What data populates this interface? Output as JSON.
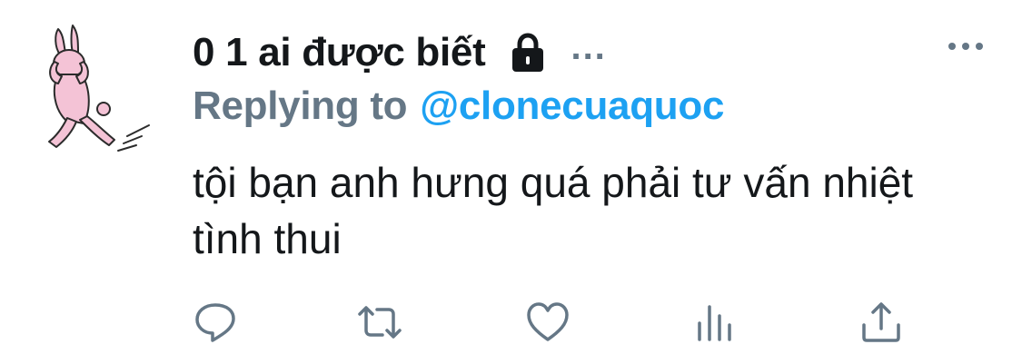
{
  "tweet": {
    "display_name": "0 1 ai được biết",
    "handle_truncated": "...",
    "replying_prefix": "Replying to",
    "replying_to": "@clonecuaquoc",
    "text": "tội bạn anh hưng quá phải tư vấn nhiệt tình thui"
  },
  "icons": {
    "avatar": "pink-rabbit-avatar",
    "lock": "lock-icon",
    "more": "more-options-icon",
    "reply": "reply-icon",
    "retweet": "retweet-icon",
    "like": "like-icon",
    "analytics": "analytics-icon",
    "share": "share-icon"
  },
  "colors": {
    "text_primary": "#14171a",
    "text_secondary": "#657786",
    "mention": "#1da1f2",
    "icon": "#657786",
    "avatar_pink": "#f4c3d6"
  }
}
